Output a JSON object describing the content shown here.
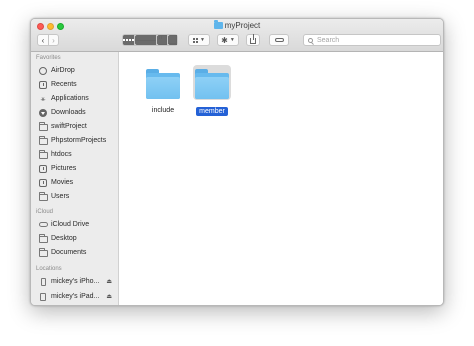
{
  "window": {
    "title": "myProject"
  },
  "toolbar": {
    "back_icon": "chevron-left",
    "forward_icon": "chevron-right",
    "view_modes": [
      "icon",
      "list",
      "columns",
      "gallery"
    ],
    "search_placeholder": "Search"
  },
  "sidebar": {
    "favorites_label": "Favorites",
    "favorites": [
      {
        "label": "AirDrop",
        "icon": "airdrop-icon"
      },
      {
        "label": "Recents",
        "icon": "recents-icon"
      },
      {
        "label": "Applications",
        "icon": "applications-icon"
      },
      {
        "label": "Downloads",
        "icon": "downloads-icon"
      },
      {
        "label": "swiftProject",
        "icon": "folder-icon"
      },
      {
        "label": "PhpstormProjects",
        "icon": "folder-icon"
      },
      {
        "label": "htdocs",
        "icon": "folder-icon"
      },
      {
        "label": "Pictures",
        "icon": "pictures-icon"
      },
      {
        "label": "Movies",
        "icon": "movies-icon"
      },
      {
        "label": "Users",
        "icon": "folder-icon"
      }
    ],
    "icloud_label": "iCloud",
    "icloud": [
      {
        "label": "iCloud Drive",
        "icon": "cloud-icon"
      },
      {
        "label": "Desktop",
        "icon": "desktop-icon"
      },
      {
        "label": "Documents",
        "icon": "documents-icon"
      }
    ],
    "locations_label": "Locations",
    "locations": [
      {
        "label": "mickey's iPho...",
        "icon": "iphone-icon"
      },
      {
        "label": "mickey's iPad...",
        "icon": "ipad-icon"
      }
    ]
  },
  "files": [
    {
      "name": "include",
      "selected": false
    },
    {
      "name": "member",
      "selected": true
    }
  ],
  "colors": {
    "selection": "#2461d6",
    "folder": "#67baee"
  }
}
